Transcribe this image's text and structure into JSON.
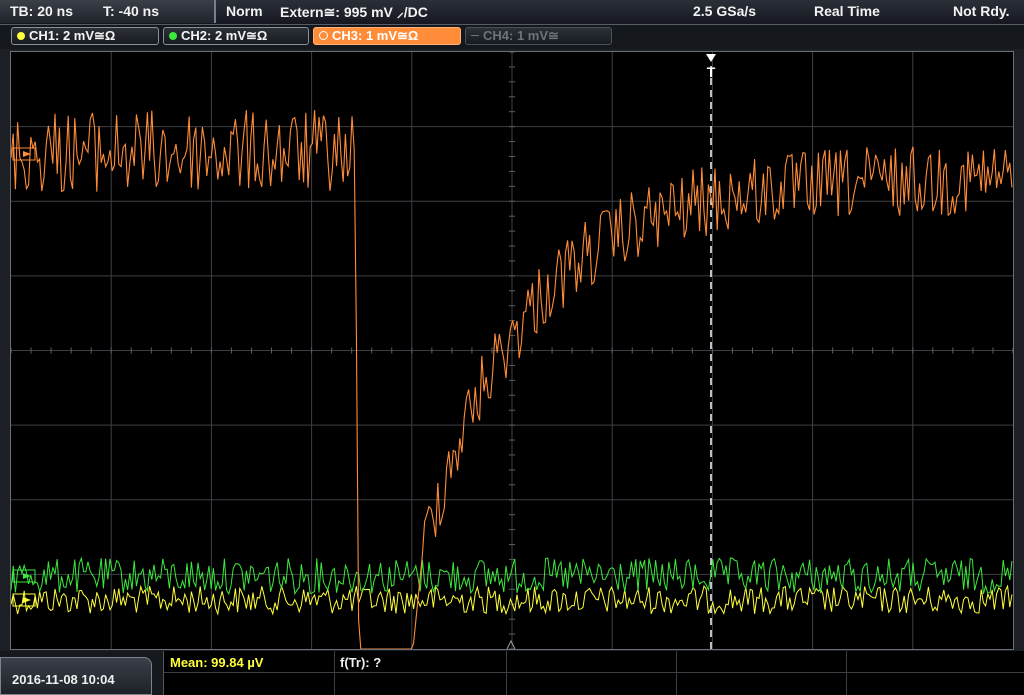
{
  "header": {
    "timebase": "TB: 20 ns",
    "trigger_time": "T: -40 ns",
    "mode": "Norm",
    "trigger_source": "Extern≅: 995 mV ⸝/DC",
    "sample_rate": "2.5 GSa/s",
    "acq_mode": "Real Time",
    "status": "Not Rdy."
  },
  "channels": [
    {
      "label": "CH1: 2 mV≅Ω",
      "color": "#ffff3a",
      "state": "on"
    },
    {
      "label": "CH2: 2 mV≅Ω",
      "color": "#3ce83c",
      "state": "on"
    },
    {
      "label": "CH3: 1 mV≅Ω",
      "color": "#ff8c38",
      "state": "active"
    },
    {
      "label": "CH4: 1 mV≅",
      "color": "#6d727a",
      "state": "off"
    }
  ],
  "trigger_marker": "T",
  "footer": {
    "datetime": "2016-11-08 10:04",
    "mean_label": "Mean: 99.84 µV",
    "ftr_label": "f(Tr): ?"
  },
  "colors": {
    "ch1": "#ffff3a",
    "ch2": "#3ce83c",
    "ch3": "#ff8c38",
    "grid": "#4a4e54",
    "mean_text": "#ffff3a"
  }
}
